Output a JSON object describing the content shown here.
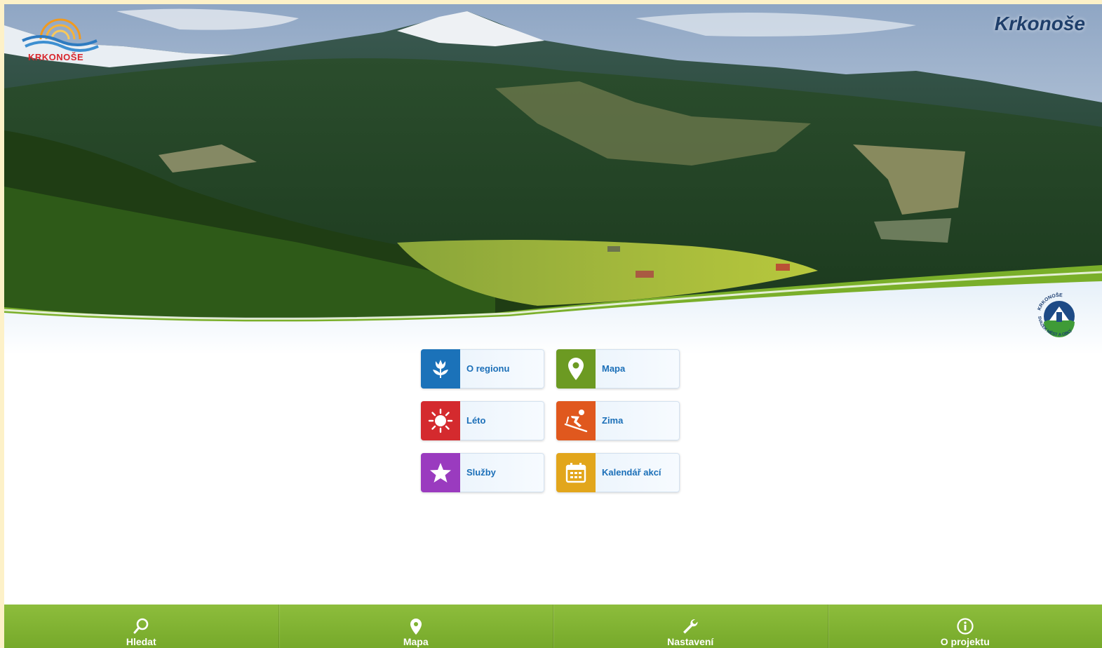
{
  "header": {
    "title": "Krkonoše",
    "brand_logo_text": "KRKONOŠE",
    "partner_logo_lines": [
      "KRKONOŠE",
      "SVAZEK MĚST A OBCÍ"
    ]
  },
  "tiles": [
    {
      "label": "O regionu",
      "icon": "tulip-icon",
      "color": "#1b72b9"
    },
    {
      "label": "Mapa",
      "icon": "map-pin-icon",
      "color": "#6c9a22"
    },
    {
      "label": "Léto",
      "icon": "sun-icon",
      "color": "#d42a2e"
    },
    {
      "label": "Zima",
      "icon": "skier-icon",
      "color": "#e0581e"
    },
    {
      "label": "Služby",
      "icon": "star-icon",
      "color": "#9a3bbf"
    },
    {
      "label": "Kalendář akcí",
      "icon": "calendar-icon",
      "color": "#e2a61c"
    }
  ],
  "bottom_nav": [
    {
      "label": "Hledat",
      "icon": "search-icon"
    },
    {
      "label": "Mapa",
      "icon": "map-pin-icon"
    },
    {
      "label": "Nastavení",
      "icon": "wrench-icon"
    },
    {
      "label": "O projektu",
      "icon": "info-icon"
    }
  ],
  "colors": {
    "nav_green": "#7fb232",
    "hero_title": "#1f3f6b",
    "tile_label": "#1b6fb8"
  }
}
